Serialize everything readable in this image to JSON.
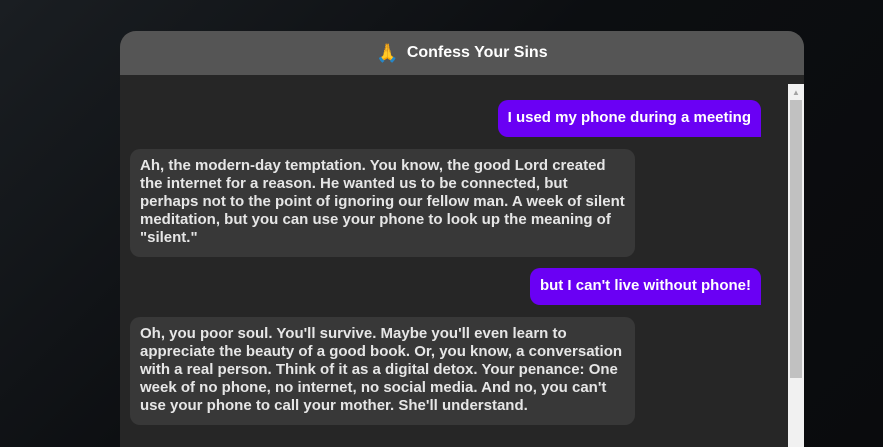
{
  "app": {
    "icon": "praying-hands-icon",
    "icon_glyph": "🙏",
    "title": "Confess Your Sins"
  },
  "colors": {
    "user_bubble": "#6a00f4",
    "bot_bubble": "#383838",
    "header": "#555555",
    "chat_background": "#262626"
  },
  "messages": [
    {
      "role": "user",
      "text": "I used my phone during a meeting"
    },
    {
      "role": "bot",
      "text": "Ah, the modern-day temptation. You know, the good Lord created the internet for a reason. He wanted us to be connected, but perhaps not to the point of ignoring our fellow man. A week of silent meditation, but you can use your phone to look up the meaning of \"silent.\""
    },
    {
      "role": "user",
      "text": "but I can't live without phone!"
    },
    {
      "role": "bot",
      "text": "Oh, you poor soul. You'll survive. Maybe you'll even learn to appreciate the beauty of a good book. Or, you know, a conversation with a real person. Think of it as a digital detox. Your penance: One week of no phone, no internet, no social media. And no, you can't use your phone to call your mother. She'll understand."
    }
  ]
}
